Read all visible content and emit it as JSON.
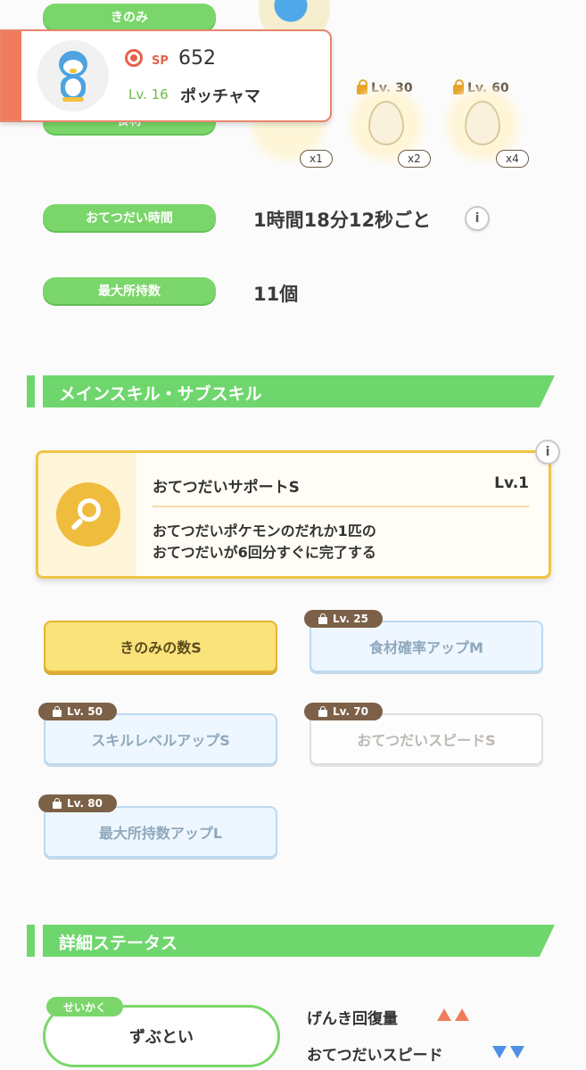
{
  "info_rows": {
    "berry_label": "きのみ",
    "ingredient_label": "食材",
    "help_time_label": "おてつだい時間",
    "help_time_value": "1時間18分12秒ごと",
    "max_carry_label": "最大所持数",
    "max_carry_value": "11個"
  },
  "ingredient_slots": [
    {
      "multiplier": "x1"
    },
    {
      "lock_level": "Lv. 30",
      "multiplier": "x2"
    },
    {
      "lock_level": "Lv. 60",
      "multiplier": "x4"
    }
  ],
  "pokemon_card": {
    "sp_label": "SP",
    "sp_value": "652",
    "level": "Lv. 16",
    "name": "ポッチャマ"
  },
  "skills_section": {
    "title": "メインスキル・サブスキル",
    "main_skill": {
      "name": "おてつだいサポートS",
      "level": "Lv.1",
      "description_lines": [
        "おてつだいポケモンのだれか1匹の",
        "おてつだいが6回分すぐに完了する"
      ],
      "icon": "magnifier-icon"
    },
    "sub_skills": [
      {
        "label": "きのみの数S",
        "lock": ""
      },
      {
        "label": "食材確率アップM",
        "lock": "Lv. 25"
      },
      {
        "label": "スキルレベルアップS",
        "lock": "Lv. 50"
      },
      {
        "label": "おてつだいスピードS",
        "lock": "Lv. 70"
      },
      {
        "label": "最大所持数アップL",
        "lock": "Lv. 80"
      }
    ]
  },
  "status_section": {
    "title": "詳細ステータス",
    "nature_tag": "せいかく",
    "nature_value": "ずぶとい",
    "up_stat": "げんき回復量",
    "down_stat": "おてつだいスピード"
  },
  "info_icon_glyph": "i",
  "colors": {
    "accent_green": "#7ad66a",
    "sp_red": "#e4634b",
    "skill_gold": "#f1c445",
    "up_arrow": "#ef7d5d",
    "down_arrow": "#4f8fe6"
  }
}
